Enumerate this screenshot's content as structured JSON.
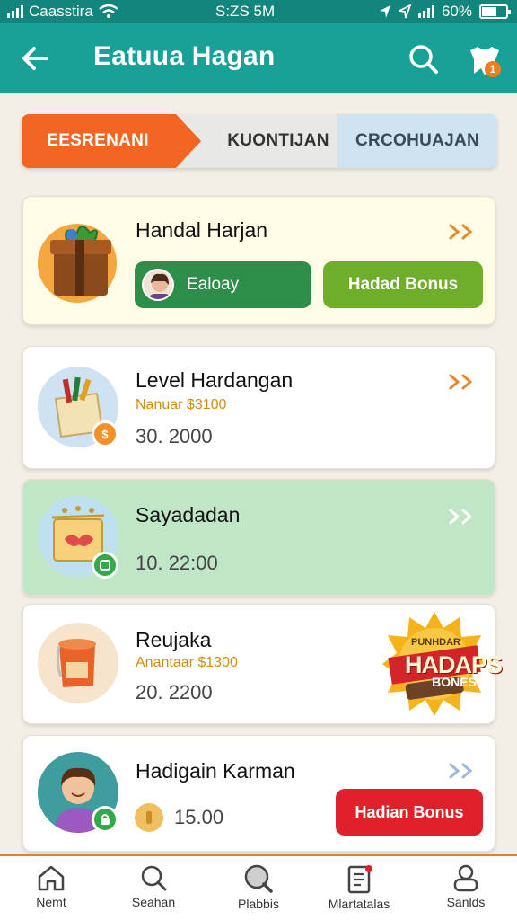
{
  "status_bar": {
    "carrier": "Caasstira",
    "time": "S:ZS 5M",
    "battery": "60%"
  },
  "header": {
    "title": "Eatuua Hagan",
    "bag_badge": "1"
  },
  "tabs": [
    {
      "label": "EESRENANI"
    },
    {
      "label": "KUONTIJAN"
    },
    {
      "label": "CRCOHUAJAN"
    }
  ],
  "cards": [
    {
      "title": "Handal Harjan",
      "daily_label": "Ealoay",
      "bonus_label": "Hadad Bonus"
    },
    {
      "title": "Level Hardangan",
      "sub": "Nanuar $3100",
      "value": "30. 2000",
      "badge": "$"
    },
    {
      "title": "Sayadadan",
      "value": "10. 22:00"
    },
    {
      "title": "Reujaka",
      "sub": "Anantaar $1300",
      "value": "20. 2200",
      "promo_small": "PUNHDAR",
      "promo_big": "HADAPS",
      "promo_bottom": "BONES"
    },
    {
      "title": "Hadigain Karman",
      "value": "15.00",
      "bonus_label": "Hadian Bonus"
    }
  ],
  "nav": [
    {
      "label": "Nemt"
    },
    {
      "label": "Seahan"
    },
    {
      "label": "Plabbis"
    },
    {
      "label": "Mlartatalas"
    },
    {
      "label": "Sanlds"
    }
  ],
  "colors": {
    "header": "#18a197",
    "tab_active": "#f26522",
    "card_highlight": "#bfe6c6",
    "bonus_green": "#6fae2a",
    "bonus_red": "#e0202a",
    "accent_orange": "#f07e1f"
  }
}
